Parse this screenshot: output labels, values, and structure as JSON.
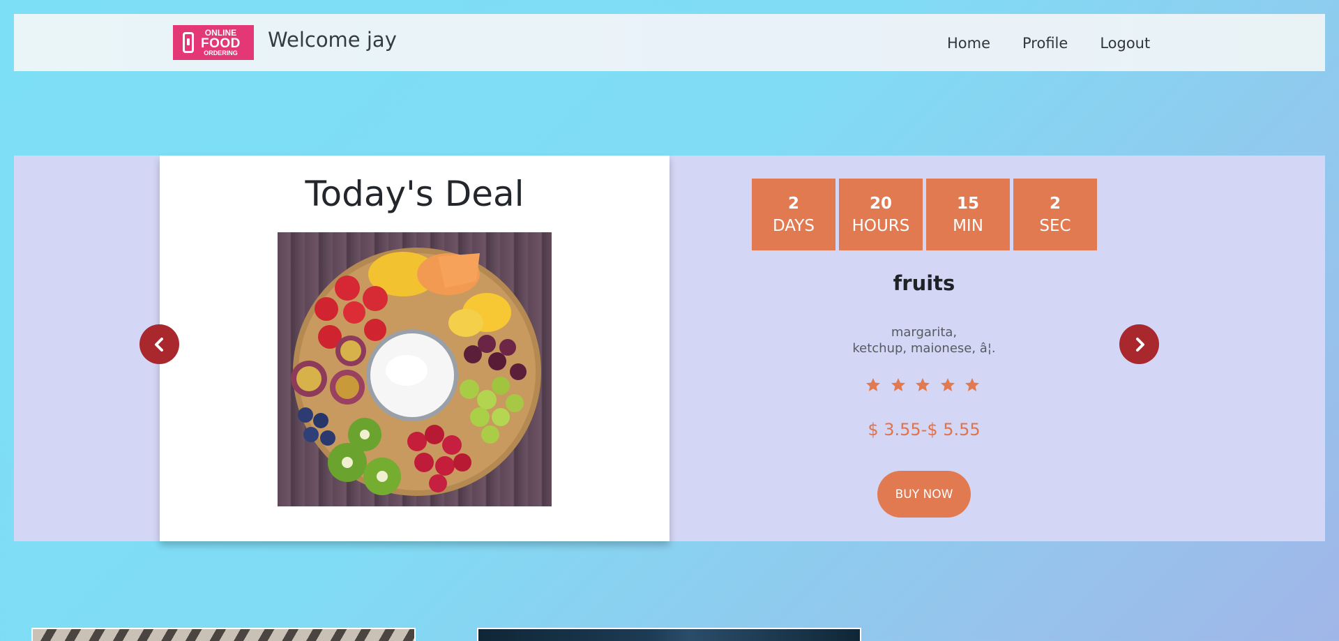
{
  "header": {
    "logo": {
      "line1": "ONLINE",
      "line2": "FOOD",
      "line3": "ORDERING",
      "color": "#e43876"
    },
    "welcome": "Welcome jay",
    "nav": [
      {
        "label": "Home"
      },
      {
        "label": "Profile"
      },
      {
        "label": "Logout"
      }
    ]
  },
  "deal": {
    "title": "Today's Deal",
    "image_icon": "fruit-platter-image",
    "countdown": [
      {
        "value": "2",
        "label": "DAYS"
      },
      {
        "value": "20",
        "label": "HOURS"
      },
      {
        "value": "15",
        "label": "MIN"
      },
      {
        "value": "2",
        "label": "SEC"
      }
    ],
    "name": "fruits",
    "description_line1": "margarita,",
    "description_line2": "ketchup, maionese, â¦.",
    "rating": 5,
    "rating_max": 5,
    "price": "$ 3.55-$ 5.55",
    "buy_label": "BUY NOW",
    "prev_icon": "chevron-left-icon",
    "next_icon": "chevron-right-icon"
  },
  "colors": {
    "accent": "#e27a51",
    "arrow": "#a8282d",
    "section_bg": "#d3d6f4"
  }
}
